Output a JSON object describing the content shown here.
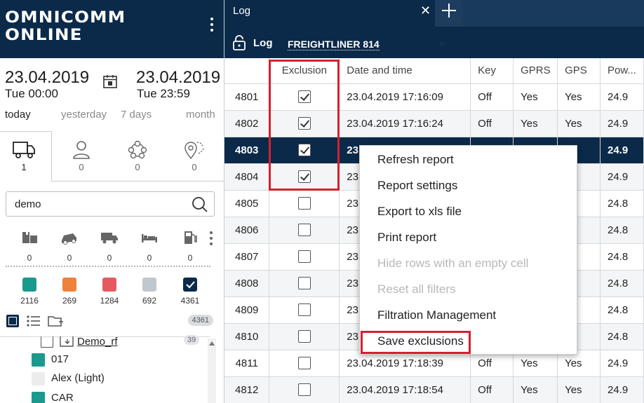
{
  "brand": {
    "line1": "OMNICOMM",
    "line2": "ONLINE"
  },
  "date_range": {
    "from_date": "23.04.2019",
    "from_time": "Tue 00:00",
    "to_date": "23.04.2019",
    "to_time": "Tue 23:59"
  },
  "periods": [
    "today",
    "yesterday",
    "7 days",
    "month"
  ],
  "object_tabs": [
    {
      "icon": "truck-icon",
      "count": "1"
    },
    {
      "icon": "person-icon",
      "count": "0"
    },
    {
      "icon": "group-icon",
      "count": "0"
    },
    {
      "icon": "geofence-icon",
      "count": "0"
    }
  ],
  "search": {
    "value": "demo"
  },
  "categories": [
    {
      "icon": "repair-icon",
      "count": "0"
    },
    {
      "icon": "accident-car-icon",
      "count": "0"
    },
    {
      "icon": "truck-small-icon",
      "count": "0"
    },
    {
      "icon": "bed-icon",
      "count": "0"
    },
    {
      "icon": "fuel-icon",
      "count": "0"
    }
  ],
  "statuses": [
    {
      "color": "#1a9a8c",
      "count": "2116"
    },
    {
      "color": "#f0813a",
      "count": "269"
    },
    {
      "color": "#e65a5f",
      "count": "1284"
    },
    {
      "color": "#c1c7ce",
      "count": "692"
    },
    {
      "color": "#0b2a4a",
      "count": "4361",
      "checked": true
    }
  ],
  "tree_badge": "4361",
  "tree": {
    "folder": {
      "label": "Demo_rf",
      "badge": "39"
    },
    "items": [
      {
        "label": "017",
        "color": "#1a9a8c"
      },
      {
        "label": "Alex (Light)",
        "color": "#ececec"
      },
      {
        "label": "CAR",
        "color": "#1a9a8c"
      }
    ]
  },
  "tab": {
    "title": "Log"
  },
  "toolbar": {
    "label": "Log",
    "vehicle": "FREIGHTLINER 814"
  },
  "table": {
    "columns": [
      "",
      "Exclusion",
      "Date and time",
      "Key",
      "GPRS",
      "GPS",
      "Pow..."
    ],
    "rows": [
      {
        "id": "4801",
        "excl": true,
        "dt": "23.04.2019 17:16:09",
        "key": "Off",
        "gprs": "Yes",
        "gps": "Yes",
        "pow": "24.9"
      },
      {
        "id": "4802",
        "excl": true,
        "dt": "23.04.2019 17:16:24",
        "key": "Off",
        "gprs": "Yes",
        "gps": "Yes",
        "pow": "24.9"
      },
      {
        "id": "4803",
        "excl": true,
        "dt": "23",
        "key": "",
        "gprs": "",
        "gps": "s",
        "pow": "24.9",
        "selected": true
      },
      {
        "id": "4804",
        "excl": true,
        "dt": "23",
        "key": "",
        "gprs": "",
        "gps": "s",
        "pow": "24.9"
      },
      {
        "id": "4805",
        "excl": false,
        "dt": "23",
        "key": "",
        "gprs": "",
        "gps": "s",
        "pow": "24.8"
      },
      {
        "id": "4806",
        "excl": false,
        "dt": "23",
        "key": "",
        "gprs": "",
        "gps": "s",
        "pow": "24.8"
      },
      {
        "id": "4807",
        "excl": false,
        "dt": "23",
        "key": "",
        "gprs": "",
        "gps": "s",
        "pow": "24.8"
      },
      {
        "id": "4808",
        "excl": false,
        "dt": "23",
        "key": "",
        "gprs": "",
        "gps": "s",
        "pow": "24.8"
      },
      {
        "id": "4809",
        "excl": false,
        "dt": "23",
        "key": "",
        "gprs": "",
        "gps": "s",
        "pow": "24.8"
      },
      {
        "id": "4810",
        "excl": false,
        "dt": "23",
        "key": "",
        "gprs": "",
        "gps": "s",
        "pow": "24.8"
      },
      {
        "id": "4811",
        "excl": false,
        "dt": "23.04.2019 17:18:39",
        "key": "Off",
        "gprs": "Yes",
        "gps": "Yes",
        "pow": "24.9"
      },
      {
        "id": "4812",
        "excl": false,
        "dt": "23.04.2019 17:18:54",
        "key": "Off",
        "gprs": "Yes",
        "gps": "Yes",
        "pow": "24.9"
      }
    ]
  },
  "context_menu": [
    {
      "label": "Refresh report",
      "enabled": true
    },
    {
      "label": "Report settings",
      "enabled": true
    },
    {
      "label": "Export to xls file",
      "enabled": true
    },
    {
      "label": "Print report",
      "enabled": true
    },
    {
      "label": "Hide rows with an empty cell",
      "enabled": false
    },
    {
      "label": "Reset all filters",
      "enabled": false
    },
    {
      "label": "Filtration Management",
      "enabled": true
    },
    {
      "label": "Save exclusions",
      "enabled": true
    }
  ],
  "colors": {
    "navy": "#0b2a4a",
    "highlight": "#d6202f"
  }
}
